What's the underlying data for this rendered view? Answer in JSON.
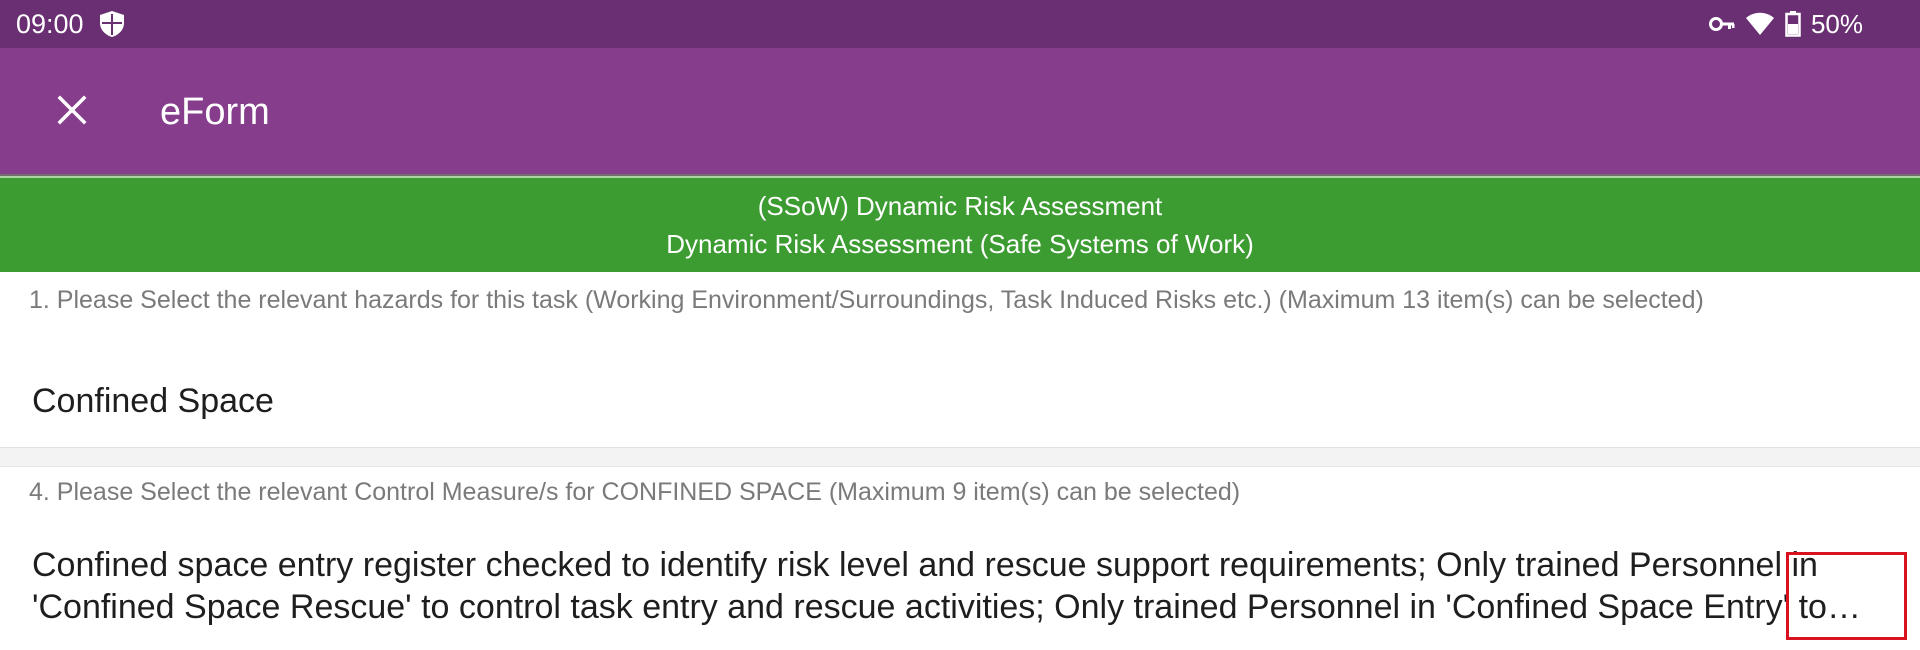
{
  "status_bar": {
    "time": "09:00",
    "battery": "50%",
    "icons": [
      "shield-icon",
      "vpn-key-icon",
      "wifi-icon",
      "battery-icon"
    ]
  },
  "app_bar": {
    "close_icon": "close-icon",
    "title": "eForm"
  },
  "form_header": {
    "line1": "(SSoW) Dynamic Risk Assessment",
    "line2": "Dynamic Risk Assessment (Safe Systems of Work)"
  },
  "questions": [
    {
      "label": "1.  Please Select the relevant hazards for this task (Working Environment/Surroundings, Task Induced Risks etc.) (Maximum 13 item(s) can be selected)",
      "answer": "Confined Space"
    },
    {
      "label": "4.  Please Select the relevant Control Measure/s for CONFINED SPACE (Maximum 9 item(s) can be selected)",
      "answer": "Confined space entry register checked to identify risk level and rescue support requirements; Only trained Personnel in 'Confined Space Rescue' to control task entry and rescue activities; Only trained Personnel in 'Confined Space Entry' to enter"
    }
  ],
  "colors": {
    "status_bar": "#6a2f73",
    "app_bar": "#853d8c",
    "form_header": "#3c9c32",
    "highlight": "#d9121f"
  }
}
